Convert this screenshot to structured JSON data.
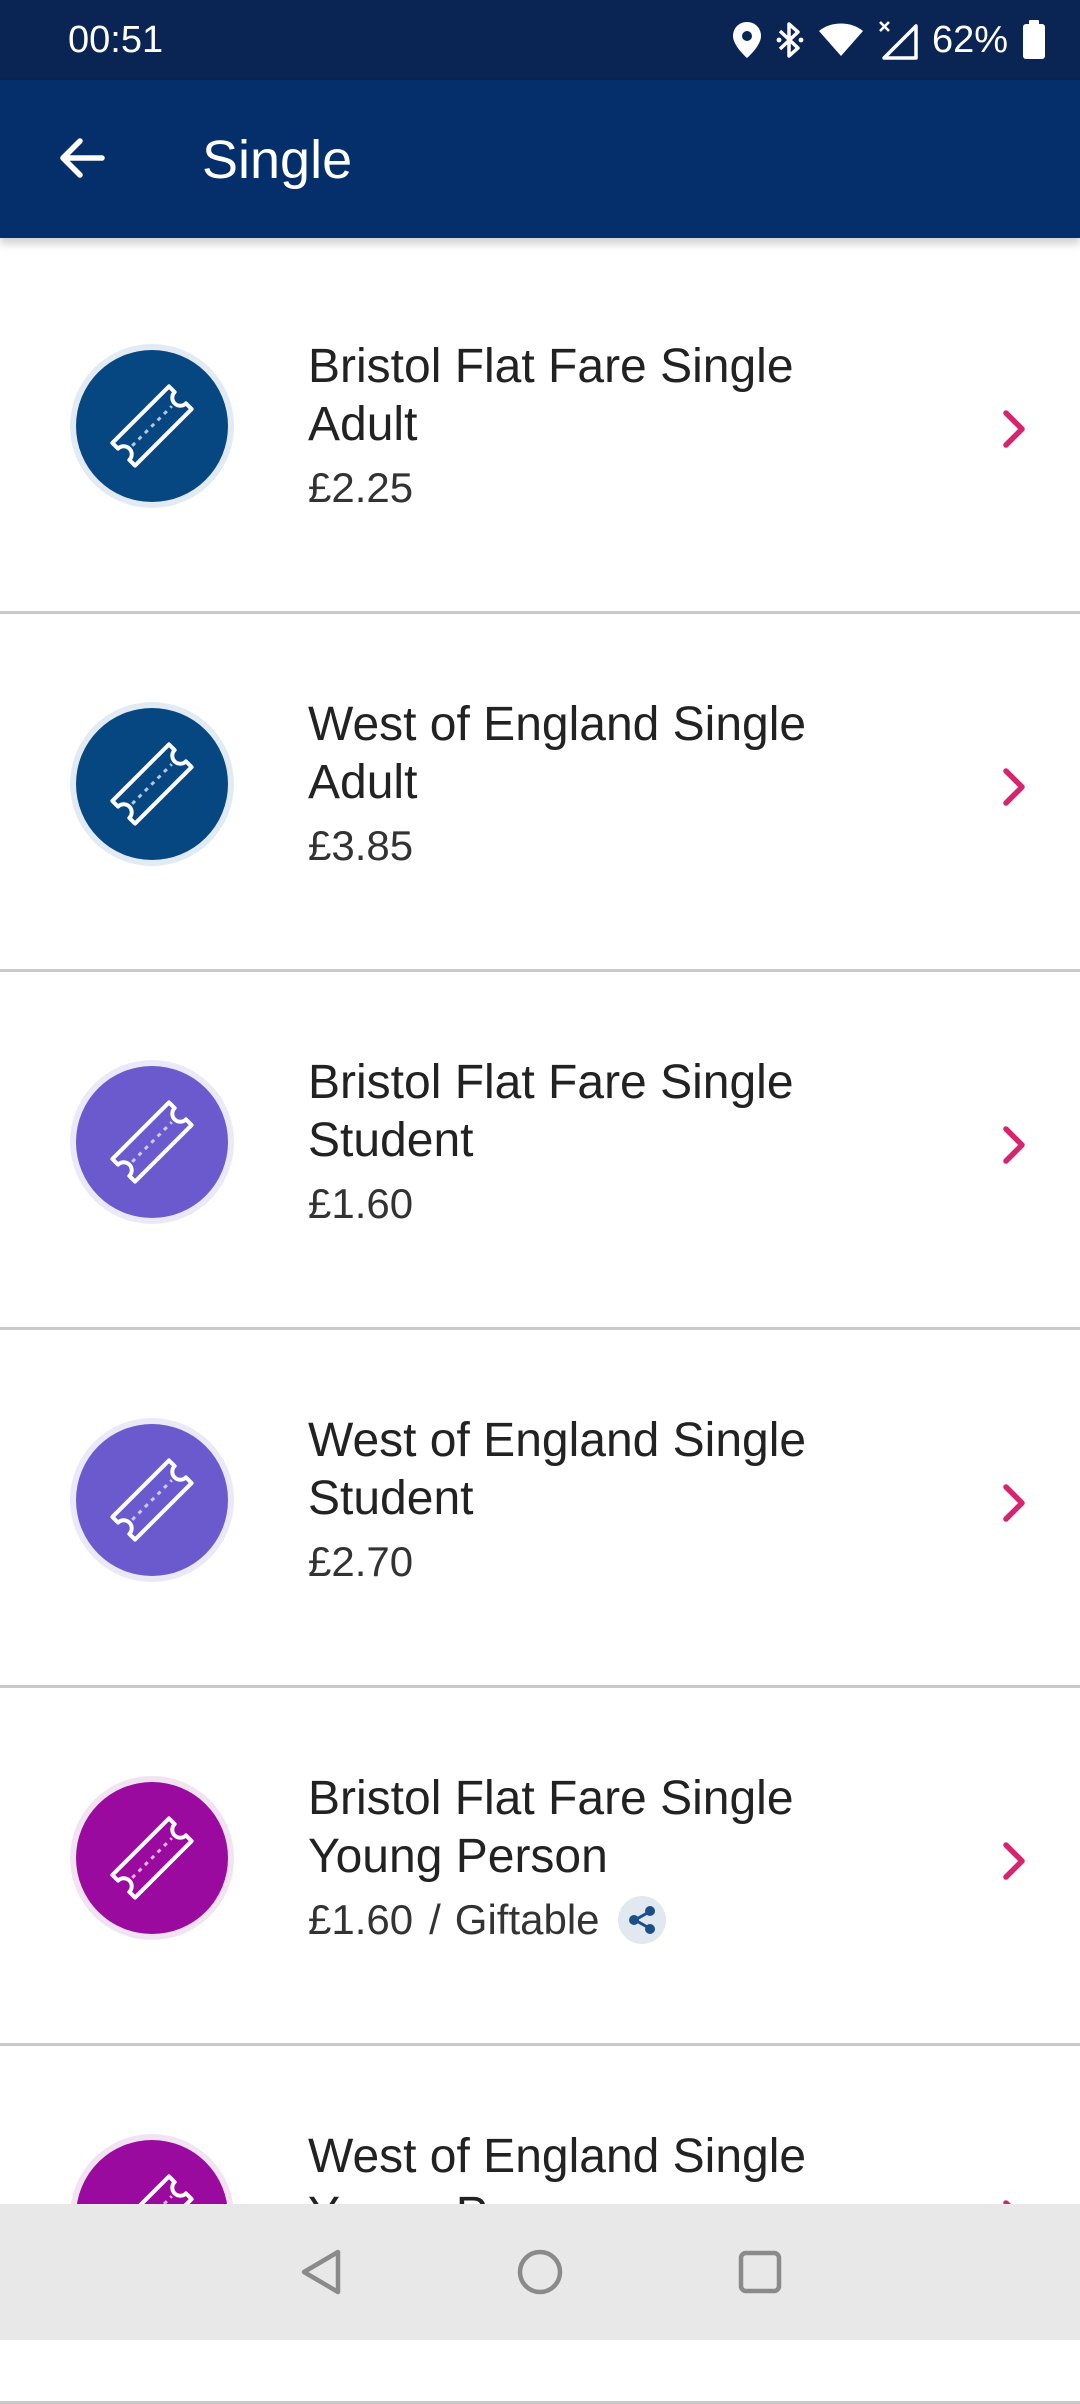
{
  "status_bar": {
    "time": "00:51",
    "battery_percent": "62%",
    "icons": [
      "location-icon",
      "bluetooth-icon",
      "wifi-icon",
      "signal-icon",
      "battery-icon"
    ]
  },
  "app_bar": {
    "title": "Single",
    "back_icon": "back-arrow-icon"
  },
  "colors": {
    "status_bar": "#0a2554",
    "app_bar": "#052f6b",
    "chevron": "#d6246e",
    "adult": "#074781",
    "student": "#6a5acd",
    "young_person": "#9b0a9f"
  },
  "tickets": [
    {
      "title_line1": "Bristol Flat Fare Single",
      "title_line2": "Adult",
      "price": "£2.25",
      "category": "adult"
    },
    {
      "title_line1": "West of England Single",
      "title_line2": "Adult",
      "price": "£3.85",
      "category": "adult"
    },
    {
      "title_line1": "Bristol Flat Fare Single",
      "title_line2": "Student",
      "price": "£1.60",
      "category": "student"
    },
    {
      "title_line1": "West of England Single",
      "title_line2": "Student",
      "price": "£2.70",
      "category": "student"
    },
    {
      "title_line1": "Bristol Flat Fare Single",
      "title_line2": "Young Person",
      "price": "£1.60",
      "separator": "/",
      "gift_label": "Giftable",
      "category": "young_person"
    },
    {
      "title_line1": "West of England Single",
      "title_line2": "Young Person",
      "price": "",
      "category": "young_person"
    }
  ],
  "nav_bar": {
    "buttons": [
      "back-triangle-icon",
      "home-circle-icon",
      "recents-square-icon"
    ]
  }
}
